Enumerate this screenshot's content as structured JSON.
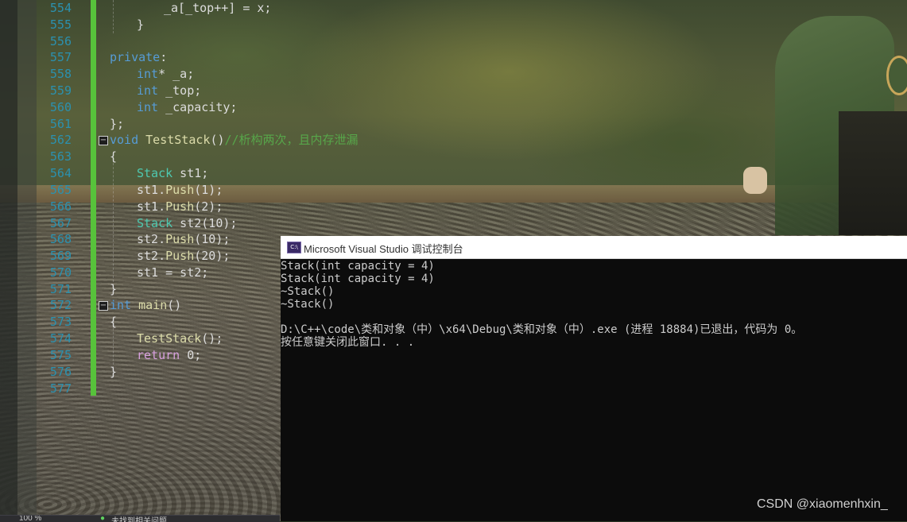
{
  "editor": {
    "line_numbers": [
      "554",
      "555",
      "556",
      "557",
      "558",
      "559",
      "560",
      "561",
      "562",
      "563",
      "564",
      "565",
      "566",
      "567",
      "568",
      "569",
      "570",
      "571",
      "572",
      "573",
      "574",
      "575",
      "576",
      "577"
    ],
    "lines": [
      [
        "_a[_top++] = x;"
      ],
      [
        "}"
      ],
      [
        ""
      ],
      [
        "private",
        ":"
      ],
      [
        "int",
        "* _a;"
      ],
      [
        "int",
        " _top;"
      ],
      [
        "int",
        " _capacity;"
      ],
      [
        "};"
      ],
      [
        "void",
        " ",
        "TestStack",
        "()",
        "//析构两次，且内存泄漏"
      ],
      [
        "{"
      ],
      [
        "Stack",
        " st1;"
      ],
      [
        "st1.",
        "Push",
        "(1);"
      ],
      [
        "st1.",
        "Push",
        "(2);"
      ],
      [
        "Stack",
        " st2(10);"
      ],
      [
        "st2.",
        "Push",
        "(10);"
      ],
      [
        "st2.",
        "Push",
        "(20);"
      ],
      [
        "st1 = st2;"
      ],
      [
        "}"
      ],
      [
        "int",
        " ",
        "main",
        "()"
      ],
      [
        "{"
      ],
      [
        "TestStack",
        "();"
      ],
      [
        "return",
        " 0;"
      ],
      [
        "}"
      ],
      [
        ""
      ]
    ],
    "status_zoom": "100 %",
    "status_issues": "未找到相关问题"
  },
  "console": {
    "icon_label": "C:\\",
    "title": "Microsoft Visual Studio 调试控制台",
    "output": [
      "Stack(int capacity = 4)",
      "Stack(int capacity = 4)",
      "~Stack()",
      "~Stack()",
      "",
      "D:\\C++\\code\\类和对象（中）\\x64\\Debug\\类和对象（中）.exe (进程 18884)已退出，代码为 0。",
      "按任意键关闭此窗口. . ."
    ]
  },
  "watermark": "CSDN @xiaomenhxin_",
  "colors": {
    "line_number": "#2b91af",
    "keyword": "#569cd6",
    "type": "#4ec9b0",
    "comment": "#57a64a",
    "control_keyword": "#d8a0df",
    "change_bar": "#57c23b",
    "console_bg": "#0c0c0c"
  }
}
